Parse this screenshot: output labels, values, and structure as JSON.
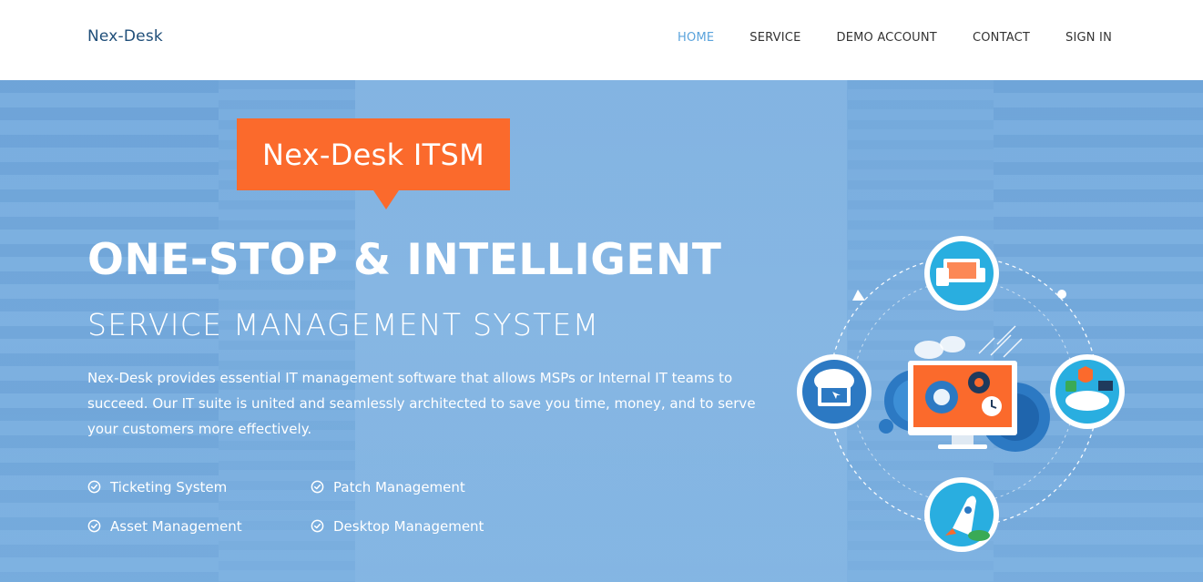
{
  "header": {
    "logo": "Nex-Desk",
    "nav": [
      {
        "label": "HOME",
        "active": true
      },
      {
        "label": "SERVICE",
        "active": false
      },
      {
        "label": "DEMO ACCOUNT",
        "active": false
      },
      {
        "label": "CONTACT",
        "active": false
      },
      {
        "label": "SIGN IN",
        "active": false
      }
    ]
  },
  "hero": {
    "badge": "Nex-Desk ITSM",
    "title": "ONE-STOP & INTELLIGENT",
    "subtitle": "SERVICE MANAGEMENT SYSTEM",
    "description": "Nex-Desk provides essential IT management software that allows MSPs or Internal IT teams to succeed. Our IT suite is united and seamlessly architected to save you time, money, and to serve your customers more effectively.",
    "features": [
      {
        "label": "Ticketing System",
        "icon": "check-circle-icon"
      },
      {
        "label": "Patch Management",
        "icon": "check-circle-icon"
      },
      {
        "label": "Asset Management",
        "icon": "check-circle-icon"
      },
      {
        "label": "Desktop Management",
        "icon": "check-circle-icon"
      }
    ]
  },
  "colors": {
    "accent": "#fb6a2c",
    "nav_active": "#5aa3dc",
    "logo": "#1f4e79",
    "hero_bg": "#82b3e0"
  }
}
